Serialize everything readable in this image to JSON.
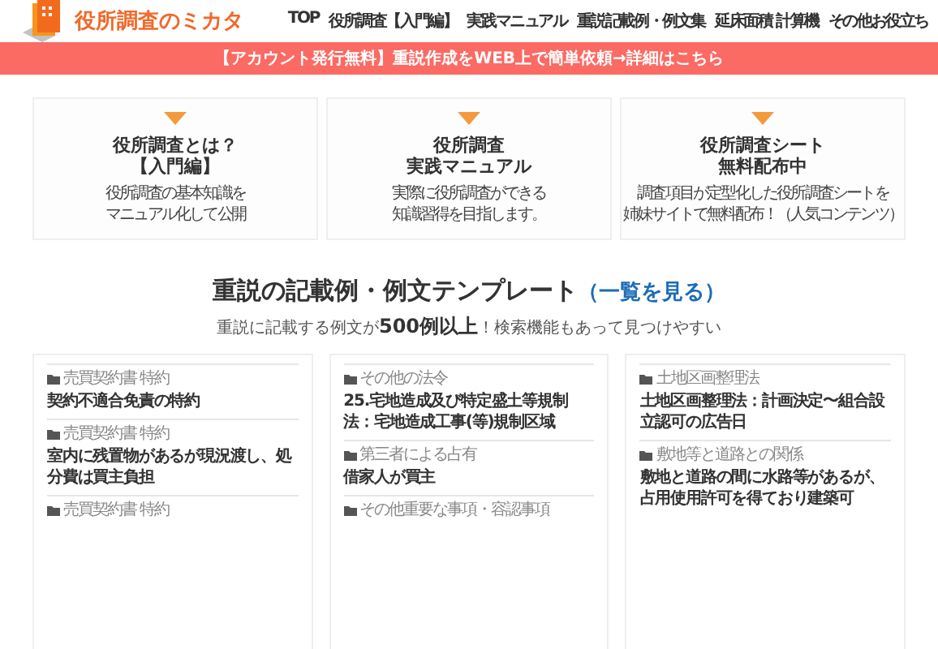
{
  "header": {
    "logo_text": "役所調査のミカタ",
    "nav": [
      "TOP",
      "役所調査【入門編】",
      "実践マニュアル",
      "重説記載例・例文集",
      "延床面積 計算機",
      "その他お役立ち"
    ]
  },
  "banner": "【アカウント発行無料】重説作成をWEB上で簡単依頼→詳細はこちら",
  "feature_cards": [
    {
      "title": [
        "役所調査とは？",
        "【入門編】"
      ],
      "description": [
        "役所調査の基本知識を",
        "マニュアル化して公開"
      ]
    },
    {
      "title": [
        "役所調査",
        "実践マニュアル"
      ],
      "description": [
        "実際に役所調査ができる",
        "知識習得を目指します。"
      ]
    },
    {
      "title": [
        "役所調査シート",
        "無料配布中"
      ],
      "description": [
        "調査項目が定型化した役所調査シートを",
        "姉妹サイトで無料配布！（人気コンテンツ）"
      ]
    }
  ],
  "section": {
    "heading": "重説の記載例・例文テンプレート",
    "link_open": "（",
    "link": "一覧を見る",
    "link_close": "）",
    "subtitle": "重説に記載する例文が**500例以上**！検索機能もあって見つけやすい"
  },
  "columns": [
    [
      {
        "category": "売買契約書 特約",
        "title": "契約不適合免責の特約"
      },
      {
        "category": "売買契約書 特約",
        "title": "室内に残置物があるが現況渡し、処分費は買主負担"
      },
      {
        "category": "売買契約書 特約"
      }
    ],
    [
      {
        "category": "その他の法令",
        "title": "25.宅地造成及び特定盛土等規制法：宅地造成工事(等)規制区域"
      },
      {
        "category": "第三者による占有",
        "title": "借家人が買主"
      },
      {
        "category": "その他重要な事項・容認事項"
      }
    ],
    [
      {
        "category": "土地区画整理法",
        "title": "土地区画整理法：計画決定〜組合設立認可の広告日"
      },
      {
        "category": "敷地等と道路との関係",
        "title": "敷地と道路の間に水路等があるが、占用使用許可を得ており建築可"
      }
    ]
  ]
}
